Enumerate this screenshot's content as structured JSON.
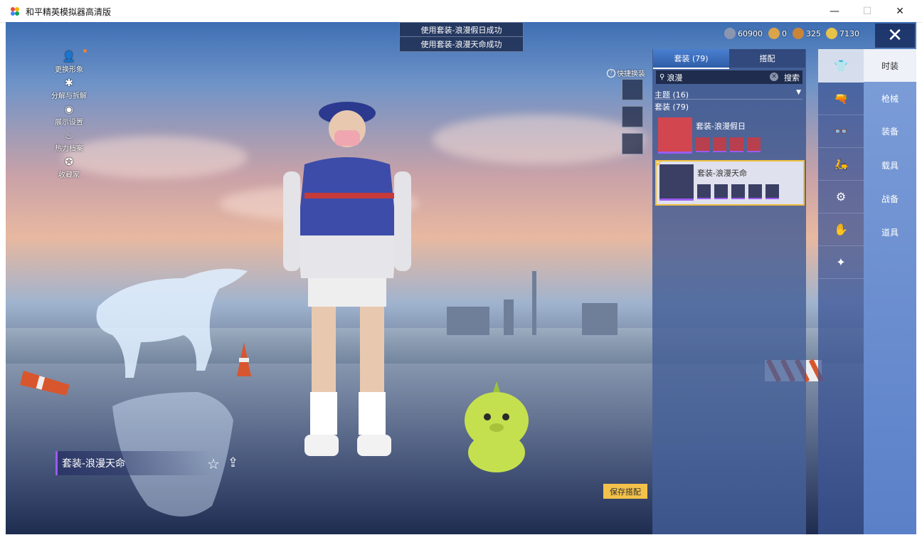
{
  "window": {
    "title": "和平精英模拟器高清版",
    "minimize": "—",
    "maximize": "☐",
    "close": "✕"
  },
  "left_menu": [
    {
      "label": "更换形象",
      "icon": "avatar-icon",
      "glyph": "👤"
    },
    {
      "label": "分解与拆解",
      "icon": "puzzle-icon",
      "glyph": "✱"
    },
    {
      "label": "展示设置",
      "icon": "eye-icon",
      "glyph": "◉"
    },
    {
      "label": "热力档案",
      "icon": "flame-icon",
      "glyph": "♨"
    },
    {
      "label": "收藏家",
      "icon": "medal-icon",
      "glyph": "✪"
    }
  ],
  "toasts": [
    "使用套装-浪漫假日成功",
    "使用套装-浪漫天命成功"
  ],
  "currencies": [
    {
      "value": "60900",
      "color": "#8a96b0"
    },
    {
      "value": "0",
      "color": "#d9a44a"
    },
    {
      "value": "325",
      "color": "#c9863a"
    },
    {
      "value": "7130",
      "color": "#e6c34a"
    }
  ],
  "close_game": "✕",
  "quick_change": {
    "label": "快捷换装",
    "icon": "help-icon",
    "glyph": "?"
  },
  "panel": {
    "tab_outfits": "套装 (79)",
    "tab_match": "搭配",
    "search_glyph": "⚲",
    "search_value": "浪漫",
    "search_clear": "✕",
    "search_button": "搜索",
    "theme_label": "主题 (16)",
    "theme_arrow": "▼",
    "outfit_count": "套装 (79)",
    "outfits": [
      {
        "name": "套装-浪漫假日",
        "selected": false
      },
      {
        "name": "套装-浪漫天命",
        "selected": true
      }
    ],
    "check": "✔"
  },
  "categories": [
    {
      "label": "时装",
      "icon": "outfit-icon",
      "glyph": "👕",
      "active": true
    },
    {
      "label": "枪械",
      "icon": "gun-icon",
      "glyph": "🔫",
      "active": false
    },
    {
      "label": "装备",
      "icon": "glasses-icon",
      "glyph": "👓",
      "active": false
    },
    {
      "label": "载具",
      "icon": "vehicle-icon",
      "glyph": "🛵",
      "active": false
    },
    {
      "label": "战备",
      "icon": "gear-icon",
      "glyph": "⚙",
      "active": false
    },
    {
      "label": "道具",
      "icon": "item-icon",
      "glyph": "✋",
      "active": false
    },
    {
      "label": "",
      "icon": "weapon-icon",
      "glyph": "✦",
      "active": false
    }
  ],
  "current_outfit": "套装-浪漫天命",
  "fav_glyph": "☆",
  "share_glyph": "⇪",
  "save_button": "保存搭配"
}
